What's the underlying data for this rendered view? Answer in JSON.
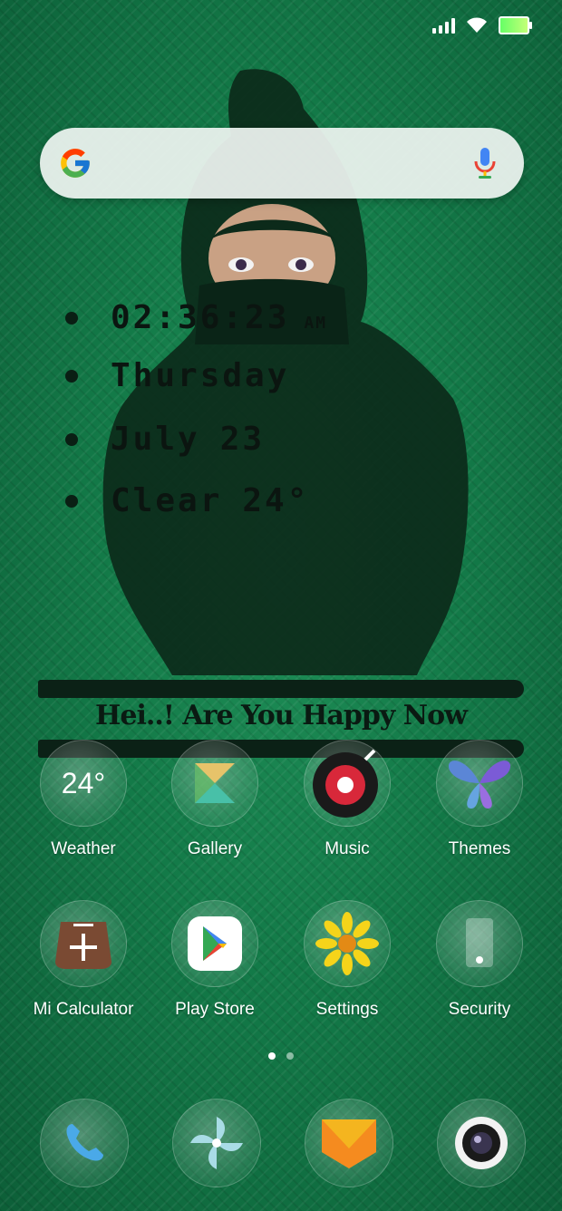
{
  "status_bar": {
    "icons": [
      "signal-icon",
      "wifi-icon",
      "battery-icon"
    ],
    "battery_color": "#7cf06a"
  },
  "search": {
    "logo": "google-g-icon",
    "voice": "microphone-icon"
  },
  "widget": {
    "time": "02:36:23",
    "ampm": "AM",
    "day": "Thursday",
    "month": "July",
    "date": "23",
    "condition": "Clear",
    "temperature": "24°",
    "accent_red": "#e5314a",
    "accent_blue": "#3b6fd8"
  },
  "banner": {
    "text": "Hei..! Are You Happy Now"
  },
  "apps": [
    {
      "label": "Weather",
      "icon": "weather-icon",
      "badge": "24°"
    },
    {
      "label": "Gallery",
      "icon": "gallery-icon"
    },
    {
      "label": "Music",
      "icon": "music-icon"
    },
    {
      "label": "Themes",
      "icon": "butterfly-icon"
    },
    {
      "label": "Mi Calculator",
      "icon": "calculator-icon"
    },
    {
      "label": "Play Store",
      "icon": "play-store-icon"
    },
    {
      "label": "Settings",
      "icon": "sunflower-icon"
    },
    {
      "label": "Security",
      "icon": "security-icon"
    }
  ],
  "page_indicator": {
    "pages": 2,
    "current": 1
  },
  "dock": [
    {
      "icon": "phone-icon"
    },
    {
      "icon": "pinwheel-icon"
    },
    {
      "icon": "messages-icon"
    },
    {
      "icon": "camera-icon"
    }
  ]
}
